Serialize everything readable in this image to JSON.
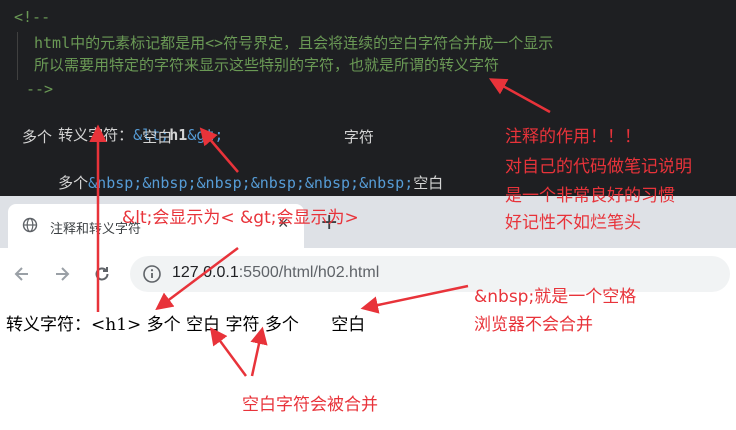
{
  "editor": {
    "comment_open": "<!--",
    "comment_line1": "html中的元素标记都是用<>符号界定，且会将连续的空白字符合并成一个显示",
    "comment_line2": "所以需要用特定的字符来显示这些特别的字符，也就是所谓的转义字符",
    "comment_close": "-->",
    "line_escape_label": "转义字符：",
    "line_escape_lt": "&lt;",
    "line_escape_h1": "h1",
    "line_escape_gt": "&gt;",
    "line_spaces": "多个          空白                   字符",
    "line_nbsp_start": "多个",
    "line_nbsp_entities": "&nbsp;&nbsp;&nbsp;&nbsp;&nbsp;&nbsp;",
    "line_nbsp_end": "空白"
  },
  "browser": {
    "tab_title": "注释和转义字符",
    "url_host": "127.0.0.1",
    "url_rest": ":5500/html/h02.html",
    "close_glyph": "×",
    "new_tab_glyph": "+"
  },
  "page": {
    "rendered_text": "转义字符：<h1> 多个 空白 字符 多个      空白"
  },
  "annotations": {
    "comment_note_1": "注释的作用！！！",
    "comment_note_2": "对自己的代码做笔记说明",
    "comment_note_3": "是一个非常良好的习惯",
    "comment_note_4": "好记性不如烂笔头",
    "entity_note": "&lt;会显示为< &gt;会显示为>",
    "nbsp_note_1": "&nbsp;就是一个空格",
    "nbsp_note_2": "浏览器不会合并",
    "merge_note": "空白字符会被合并"
  },
  "colors": {
    "annotation": "#e8333a",
    "editor_bg": "#1e1f22",
    "comment": "#6a9955",
    "entity": "#569cd6"
  }
}
